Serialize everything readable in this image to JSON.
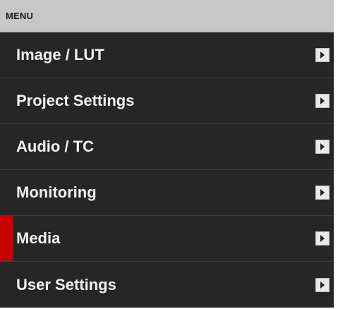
{
  "header": {
    "title": "MENU"
  },
  "menu": {
    "items": [
      {
        "label": "Image / LUT",
        "icon": "chevron-right-icon",
        "selected": false
      },
      {
        "label": "Project Settings",
        "icon": "chevron-right-icon",
        "selected": false
      },
      {
        "label": "Audio / TC",
        "icon": "chevron-right-icon",
        "selected": false
      },
      {
        "label": "Monitoring",
        "icon": "chevron-right-icon",
        "selected": false
      },
      {
        "label": "Media",
        "icon": "chevron-right-icon",
        "selected": true
      },
      {
        "label": "User Settings",
        "icon": "chevron-right-icon",
        "selected": false
      }
    ]
  },
  "colors": {
    "background": "#262626",
    "header_background": "#c7c7c7",
    "selected_indicator": "#c60000",
    "text": "#f2f2f2"
  }
}
